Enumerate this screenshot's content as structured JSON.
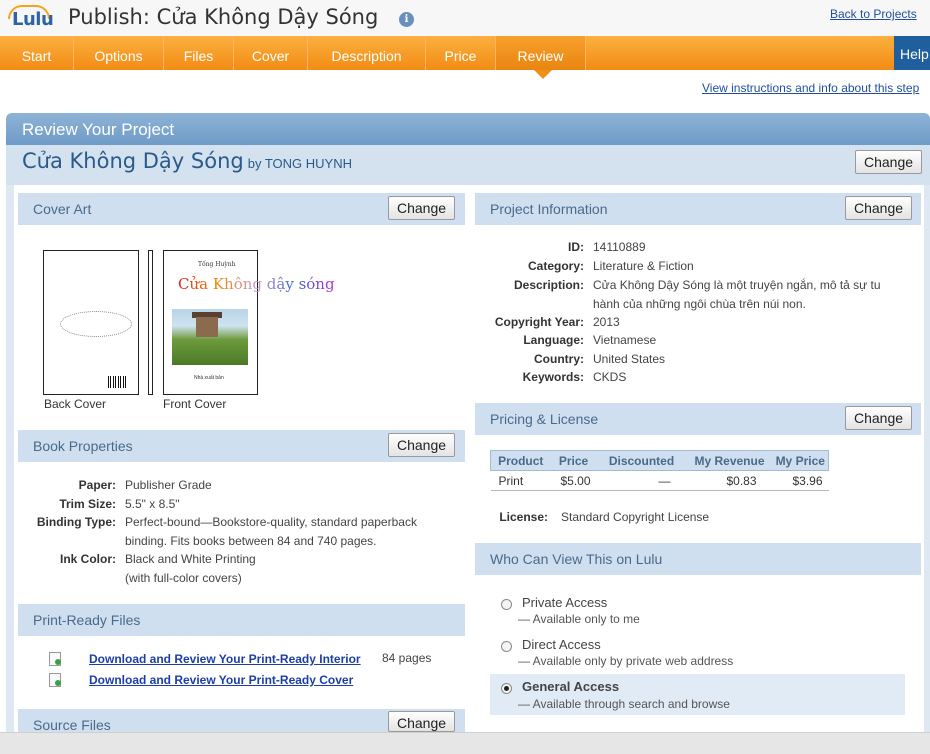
{
  "header": {
    "logo_text": "Lulu",
    "title": "Publish: Cửa Không Dậy Sóng",
    "back_link": "Back to Projects"
  },
  "nav": {
    "tabs": [
      "Start",
      "Options",
      "Files",
      "Cover",
      "Description",
      "Price",
      "Review"
    ],
    "active": "Review",
    "help": "Help",
    "instructions_link": "View instructions and info about this step"
  },
  "review": {
    "heading": "Review Your Project",
    "project_title": "Cửa Không Dậy Sóng",
    "by_author": "by TONG HUYNH",
    "change_label": "Change"
  },
  "cover_art": {
    "heading": "Cover Art",
    "back_caption": "Back Cover",
    "front_caption": "Front Cover",
    "front_title": "Cửa Không dậy sóng",
    "front_author": "Tống Huỳnh",
    "front_publisher": "Nhà xuất bản"
  },
  "book_properties": {
    "heading": "Book Properties",
    "rows": [
      {
        "label": "Paper:",
        "value": "Publisher Grade"
      },
      {
        "label": "Trim Size:",
        "value": "5.5\" x 8.5\""
      },
      {
        "label": "Binding Type:",
        "value": "Perfect-bound—Bookstore-quality, standard paperback binding. Fits books between 84 and 740 pages."
      },
      {
        "label": "Ink Color:",
        "value": "Black and White Printing (with full-color covers)"
      }
    ]
  },
  "print_ready": {
    "heading": "Print-Ready Files",
    "interior_link": "Download and Review Your Print-Ready Interior",
    "interior_pages": "84 pages",
    "cover_link": "Download and Review Your Print-Ready Cover"
  },
  "source_files": {
    "heading": "Source Files"
  },
  "project_info": {
    "heading": "Project Information",
    "rows": [
      {
        "label": "ID:",
        "value": "14110889"
      },
      {
        "label": "Category:",
        "value": "Literature & Fiction"
      },
      {
        "label": "Description:",
        "value": "Cửa Không Dậy Sóng là một truyện ngắn, mô tả sự tu hành của những ngôi chùa trên núi non."
      },
      {
        "label": "Copyright Year:",
        "value": "2013"
      },
      {
        "label": "Language:",
        "value": "Vietnamese"
      },
      {
        "label": "Country:",
        "value": "United States"
      },
      {
        "label": "Keywords:",
        "value": "CKDS"
      }
    ]
  },
  "pricing": {
    "heading": "Pricing & License",
    "columns": [
      "Product",
      "Price",
      "Discounted",
      "My Revenue",
      "My Price"
    ],
    "row": [
      "Print",
      "$5.00",
      "—",
      "$0.83",
      "$3.96"
    ],
    "license_label": "License:",
    "license_value": "Standard Copyright License"
  },
  "access": {
    "heading": "Who Can View This on Lulu",
    "options": [
      {
        "title": "Private Access",
        "desc": "— Available only to me",
        "checked": false
      },
      {
        "title": "Direct Access",
        "desc": "— Available only by private web address",
        "checked": false
      },
      {
        "title": "General Access",
        "desc": "— Available through search and browse",
        "checked": true
      }
    ]
  },
  "icons": {
    "info": "info-icon",
    "file": "file-download-icon",
    "radio": "radio-icon"
  }
}
